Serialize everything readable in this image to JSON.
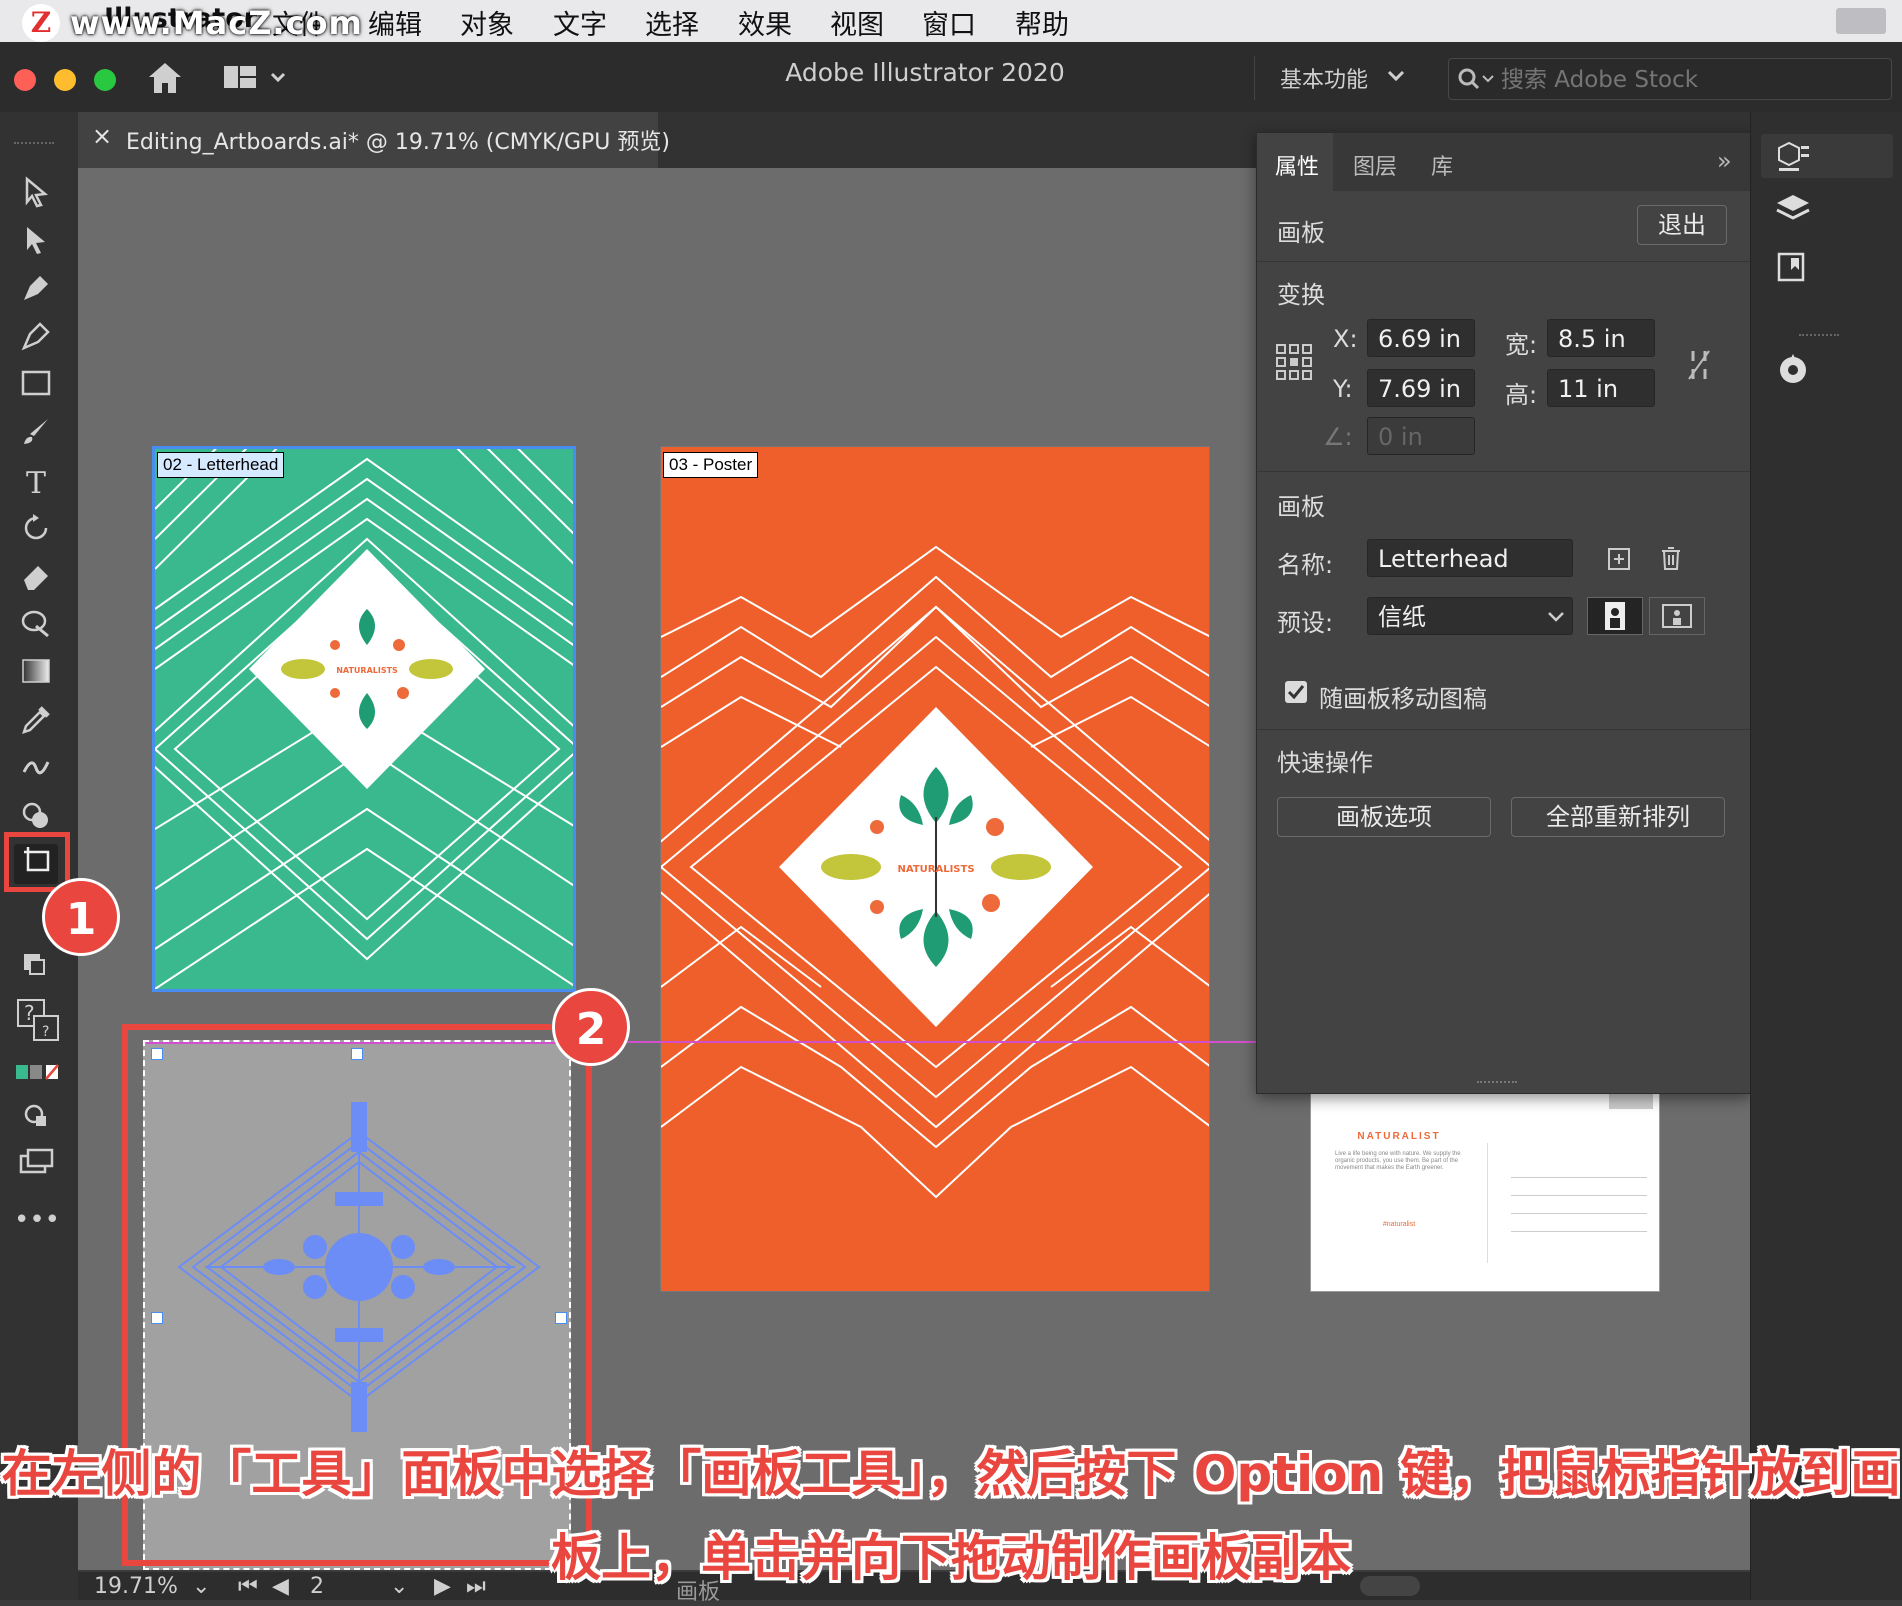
{
  "menubar": {
    "watermark": "www.MacZ.com",
    "logo_letter": "Z",
    "app_name": "Illustrator",
    "items": [
      "文件",
      "编辑",
      "对象",
      "文字",
      "选择",
      "效果",
      "视图",
      "窗口",
      "帮助"
    ]
  },
  "appbar": {
    "title": "Adobe Illustrator 2020",
    "workspace": "基本功能",
    "search_placeholder": "搜索 Adobe Stock"
  },
  "document_tab": {
    "label": "Editing_Artboards.ai* @ 19.71% (CMYK/GPU 预览)",
    "close": "×"
  },
  "properties_panel": {
    "tabs": [
      "属性",
      "图层",
      "库"
    ],
    "active_tab": "属性",
    "section_artboard": "画板",
    "exit_button": "退出",
    "section_transform": "变换",
    "x_label": "X:",
    "x_value": "6.69 in",
    "y_label": "Y:",
    "y_value": "7.69 in",
    "w_label": "宽:",
    "w_value": "8.5 in",
    "h_label": "高:",
    "h_value": "11 in",
    "angle_value": "0 in",
    "section_artboard2": "画板",
    "name_label": "名称:",
    "name_value": "Letterhead",
    "preset_label": "预设:",
    "preset_value": "信纸",
    "move_artwork_checkbox": "随画板移动图稿",
    "move_artwork_checked": true,
    "section_quick": "快速操作",
    "artboard_options_button": "画板选项",
    "rearrange_button": "全部重新排列"
  },
  "artboards": [
    {
      "label": "02 - Letterhead",
      "color": "#3ab98e"
    },
    {
      "label": "03 - Poster",
      "color": "#ee5f2b"
    }
  ],
  "postcard": {
    "brand": "NATURALIST",
    "body": "Live a life being one with nature. We supply the organic products, you use them. Be part of the movement that makes the Earth greener.",
    "tag": "#naturalist"
  },
  "logo_text": "NATURALISTS",
  "badges": [
    "1",
    "2"
  ],
  "caption": {
    "line1": "在左侧的「工具」面板中选择「画板工具」，然后按下 Option 键，把鼠标指针放到画",
    "line2": "板上，单击并向下拖动制作画板副本"
  },
  "statusbar": {
    "zoom": "19.71%",
    "artboard_number": "2",
    "mode_label": "画板"
  },
  "colors": {
    "accent_red": "#e8463e",
    "letterhead_green": "#3ab98e",
    "poster_orange": "#ee5f2b",
    "selection_blue": "#4a8df0"
  }
}
